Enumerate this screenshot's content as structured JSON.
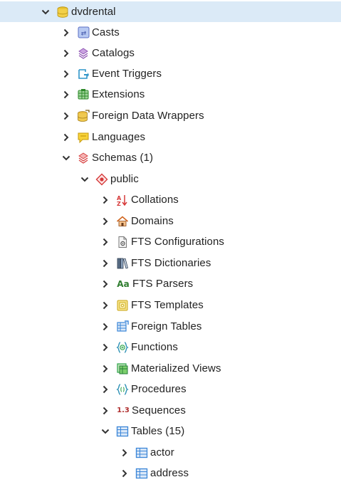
{
  "tree": {
    "database": {
      "label": "dvdrental"
    },
    "db_children": [
      {
        "key": "casts",
        "label": "Casts"
      },
      {
        "key": "catalogs",
        "label": "Catalogs"
      },
      {
        "key": "event-triggers",
        "label": "Event Triggers"
      },
      {
        "key": "extensions",
        "label": "Extensions"
      },
      {
        "key": "foreign-data-wrappers",
        "label": "Foreign Data Wrappers"
      },
      {
        "key": "languages",
        "label": "Languages"
      },
      {
        "key": "schemas",
        "label": "Schemas (1)"
      }
    ],
    "schema": {
      "label": "public"
    },
    "schema_children": [
      {
        "key": "collations",
        "label": "Collations"
      },
      {
        "key": "domains",
        "label": "Domains"
      },
      {
        "key": "fts-configurations",
        "label": "FTS Configurations"
      },
      {
        "key": "fts-dictionaries",
        "label": "FTS Dictionaries"
      },
      {
        "key": "fts-parsers",
        "label": "FTS Parsers"
      },
      {
        "key": "fts-templates",
        "label": "FTS Templates"
      },
      {
        "key": "foreign-tables",
        "label": "Foreign Tables"
      },
      {
        "key": "functions",
        "label": "Functions"
      },
      {
        "key": "materialized-views",
        "label": "Materialized Views"
      },
      {
        "key": "procedures",
        "label": "Procedures"
      },
      {
        "key": "sequences",
        "label": "Sequences"
      },
      {
        "key": "tables",
        "label": "Tables (15)"
      }
    ],
    "tables": [
      {
        "label": "actor"
      },
      {
        "label": "address"
      }
    ],
    "fts_parsers_icon_text": "Aa",
    "sequences_icon_text": "1.3"
  },
  "colors": {
    "selected_row": "#dbeaf7",
    "database_icon": "#e8c12c",
    "table_icon": "#3b86d8",
    "schema_icon": "#d63a3a"
  }
}
